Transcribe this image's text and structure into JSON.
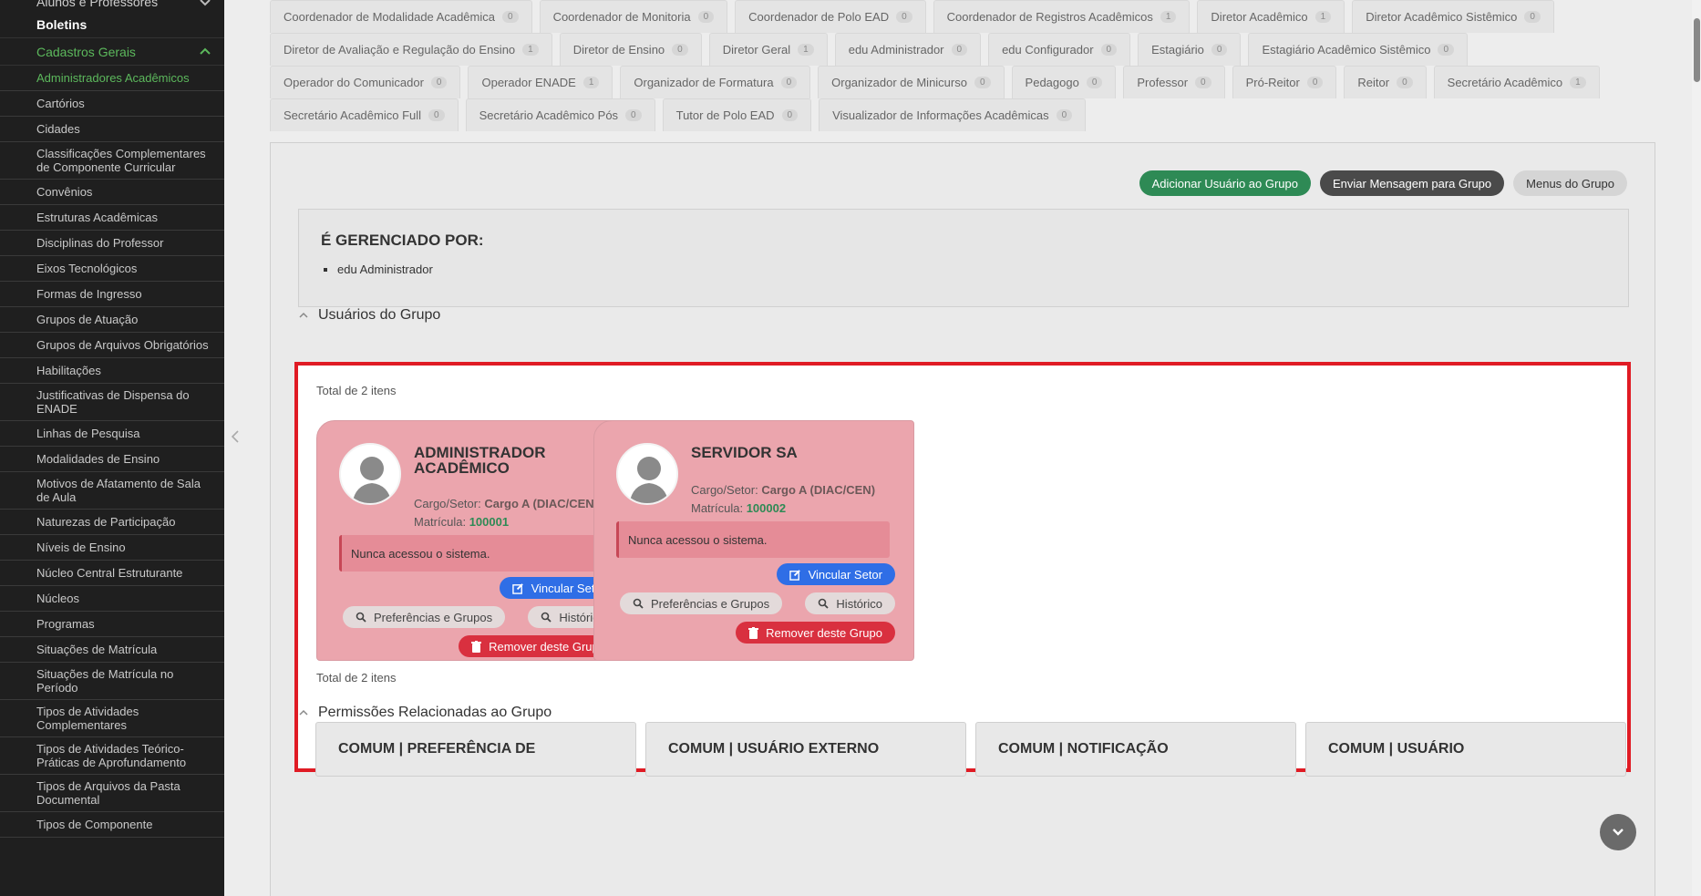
{
  "sidebar": {
    "top_item": "Alunos e Professores",
    "boletins": "Boletins",
    "section": "Cadastros Gerais",
    "items": [
      "Administradores Acadêmicos",
      "Cartórios",
      "Cidades",
      "Classificações Complementares de Componente Curricular",
      "Convênios",
      "Estruturas Acadêmicas",
      "Disciplinas do Professor",
      "Eixos Tecnológicos",
      "Formas de Ingresso",
      "Grupos de Atuação",
      "Grupos de Arquivos Obrigatórios",
      "Habilitações",
      "Justificativas de Dispensa do ENADE",
      "Linhas de Pesquisa",
      "Modalidades de Ensino",
      "Motivos de Afatamento de Sala de Aula",
      "Naturezas de Participação",
      "Níveis de Ensino",
      "Núcleo Central Estruturante",
      "Núcleos",
      "Programas",
      "Situações de Matrícula",
      "Situações de Matrícula no Período",
      "Tipos de Atividades Complementares",
      "Tipos de Atividades Teórico-Práticas de Aprofundamento",
      "Tipos de Arquivos da Pasta Documental",
      "Tipos de Componente"
    ]
  },
  "tabs": [
    [
      {
        "label": "Coordenador de Modalidade Acadêmica",
        "count": "0"
      },
      {
        "label": "Coordenador de Monitoria",
        "count": "0"
      },
      {
        "label": "Coordenador de Polo EAD",
        "count": "0"
      },
      {
        "label": "Coordenador de Registros Acadêmicos",
        "count": "1"
      },
      {
        "label": "Diretor Acadêmico",
        "count": "1"
      },
      {
        "label": "Diretor Acadêmico Sistêmico",
        "count": "0"
      }
    ],
    [
      {
        "label": "Diretor de Avaliação e Regulação do Ensino",
        "count": "1"
      },
      {
        "label": "Diretor de Ensino",
        "count": "0"
      },
      {
        "label": "Diretor Geral",
        "count": "1"
      },
      {
        "label": "edu Administrador",
        "count": "0"
      },
      {
        "label": "edu Configurador",
        "count": "0"
      },
      {
        "label": "Estagiário",
        "count": "0"
      },
      {
        "label": "Estagiário Acadêmico Sistêmico",
        "count": "0"
      }
    ],
    [
      {
        "label": "Operador do Comunicador",
        "count": "0"
      },
      {
        "label": "Operador ENADE",
        "count": "1"
      },
      {
        "label": "Organizador de Formatura",
        "count": "0"
      },
      {
        "label": "Organizador de Minicurso",
        "count": "0"
      },
      {
        "label": "Pedagogo",
        "count": "0"
      },
      {
        "label": "Professor",
        "count": "0"
      },
      {
        "label": "Pró-Reitor",
        "count": "0"
      },
      {
        "label": "Reitor",
        "count": "0"
      },
      {
        "label": "Secretário Acadêmico",
        "count": "1"
      }
    ],
    [
      {
        "label": "Secretário Acadêmico Full",
        "count": "0"
      },
      {
        "label": "Secretário Acadêmico Pós",
        "count": "0"
      },
      {
        "label": "Tutor de Polo EAD",
        "count": "0"
      },
      {
        "label": "Visualizador de Informações Acadêmicas",
        "count": "0"
      }
    ]
  ],
  "actions": {
    "add_user": "Adicionar Usuário ao Grupo",
    "send_message": "Enviar Mensagem para Grupo",
    "group_menus": "Menus do Grupo"
  },
  "managed": {
    "title": "É GERENCIADO POR:",
    "items": [
      "edu Administrador"
    ]
  },
  "users_section": {
    "title": "Usuários do Grupo",
    "total_top": "Total de 2 itens",
    "total_bottom": "Total de 2 itens",
    "cards": [
      {
        "name": "ADMINISTRADOR ACADÊMICO",
        "cargo_label": "Cargo/Setor:",
        "cargo_value": "Cargo A (DIAC/CEN)",
        "matricula_label": "Matrícula:",
        "matricula_value": "100001",
        "alert": "Nunca acessou o sistema.",
        "btn_vincular": "Vincular Setor",
        "btn_preferencias": "Preferências e Grupos",
        "btn_historico": "Histórico",
        "btn_remover": "Remover deste Grupo"
      },
      {
        "name": "SERVIDOR SA",
        "cargo_label": "Cargo/Setor:",
        "cargo_value": "Cargo A (DIAC/CEN)",
        "matricula_label": "Matrícula:",
        "matricula_value": "100002",
        "alert": "Nunca acessou o sistema.",
        "btn_vincular": "Vincular Setor",
        "btn_preferencias": "Preferências e Grupos",
        "btn_historico": "Histórico",
        "btn_remover": "Remover deste Grupo"
      }
    ]
  },
  "permissions_section": {
    "title": "Permissões Relacionadas ao Grupo",
    "cards": [
      "COMUM | PREFERÊNCIA DE",
      "COMUM | USUÁRIO EXTERNO",
      "COMUM | NOTIFICAÇÃO",
      "COMUM | USUÁRIO"
    ]
  },
  "colors": {
    "highlight_border": "#e01b24",
    "card_bg": "#eba5ad",
    "accent_green": "#2e8a55",
    "button_blue": "#2f6ee6",
    "button_red": "#d9303f"
  }
}
